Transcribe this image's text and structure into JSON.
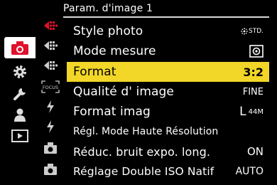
{
  "header": {
    "title": "Param. d'image 1"
  },
  "menu": {
    "items": [
      {
        "label": "Style photo",
        "value": "STD.",
        "value_icon": "photo-style-icon"
      },
      {
        "label": "Mode mesure",
        "value": "",
        "value_icon": "metering-mode-icon"
      },
      {
        "label": "Format",
        "value": "3:2",
        "selected": true
      },
      {
        "label": "Qualité d' image",
        "value": "FINE"
      },
      {
        "label": "Format imag",
        "value": "L",
        "value_suffix": "44M"
      },
      {
        "label": "Régl. Mode Haute Résolution",
        "value": ""
      },
      {
        "label": "Réduc. bruit expo. long.",
        "value": "ON"
      },
      {
        "label": "Réglage Double ISO Natif",
        "value": "AUTO"
      }
    ]
  },
  "sidebar": {
    "items": [
      {
        "icon": "camera-icon",
        "active": true
      },
      {
        "icon": "gear-icon"
      },
      {
        "icon": "wrench-icon"
      },
      {
        "icon": "person-icon"
      },
      {
        "icon": "playback-icon"
      }
    ]
  },
  "subcolumn": {
    "items": [
      {
        "icon": "tab-arrows-icon",
        "active": true
      },
      {
        "icon": "tab-arrows-icon"
      },
      {
        "icon": "tab-arrows-icon"
      },
      {
        "icon": "focus-icon",
        "text": "FOCUS"
      },
      {
        "icon": "flash-icon"
      },
      {
        "icon": "flash-icon"
      },
      {
        "icon": "camera-sub-icon"
      },
      {
        "icon": "camera-sub-icon"
      }
    ]
  },
  "colors": {
    "accent": "#e0112b",
    "highlight": "#f2d628",
    "background": "#000000"
  }
}
